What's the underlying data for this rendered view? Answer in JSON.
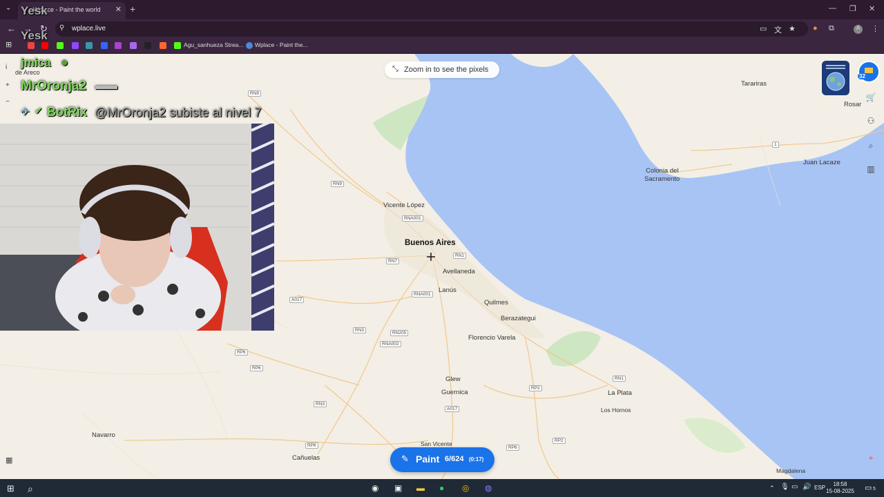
{
  "browser": {
    "tab_title": "Wplace - Paint the world",
    "url": "wplace.live",
    "bookmarks": [
      {
        "label": "Agu_sanhueza Strea..."
      },
      {
        "label": "Wplace - Paint the..."
      }
    ]
  },
  "map": {
    "zoom_hint": "Zoom in to see the pixels",
    "places": [
      {
        "label": "Tarariras",
        "big": false
      },
      {
        "label": "Rosar",
        "big": false
      },
      {
        "label": "Colonia del",
        "big": false
      },
      {
        "label": "Sacramento",
        "big": false
      },
      {
        "label": "Juan Lacaze",
        "big": false
      },
      {
        "label": "Vicente López",
        "big": false
      },
      {
        "label": "Buenos Aires",
        "big": true
      },
      {
        "label": "Avellaneda",
        "big": false
      },
      {
        "label": "Lanús",
        "big": false
      },
      {
        "label": "Quilmes",
        "big": false
      },
      {
        "label": "Berazategui",
        "big": false
      },
      {
        "label": "Florencio Varela",
        "big": false
      },
      {
        "label": "Glew",
        "big": false
      },
      {
        "label": "Guernica",
        "big": false
      },
      {
        "label": "La Plata",
        "big": false
      },
      {
        "label": "Los Hornos",
        "big": false
      },
      {
        "label": "Navarro",
        "big": false
      },
      {
        "label": "Cañuelas",
        "big": false
      },
      {
        "label": "San Vicente",
        "big": false
      },
      {
        "label": "Magdalena",
        "big": false
      },
      {
        "label": "de Areco",
        "big": false
      }
    ],
    "roads": [
      "RN9",
      "RN9",
      "RNA001",
      "RN7",
      "RN1",
      "RNA001",
      "A017",
      "RN3",
      "RN205",
      "RNA002",
      "RP6",
      "RP6",
      "RN3",
      "A017",
      "RP2",
      "RN1",
      "RP2",
      "RP6",
      "RP6",
      "1"
    ]
  },
  "paint_button": {
    "label": "Paint",
    "count": "6/624",
    "timer": "(0:17)"
  },
  "user": {
    "level": "32"
  },
  "stream_overlay": {
    "chat": [
      {
        "user": "Yesk",
        "message": ""
      },
      {
        "user": "Yesk",
        "message": ""
      },
      {
        "user": "jmica",
        "message": ""
      },
      {
        "user": "MrOronja2",
        "message": ""
      },
      {
        "user": "BotRix",
        "message": "@MrOronja2 subiste al nivel 7"
      }
    ]
  },
  "taskbar": {
    "lang": "ESP",
    "time": "18:58",
    "date": "15-08-2025",
    "notif": "5"
  },
  "colors": {
    "accent": "#1a73e8",
    "water": "#a8c4f5",
    "land": "#f3efe6",
    "green_chat": "#7fdc5a"
  }
}
